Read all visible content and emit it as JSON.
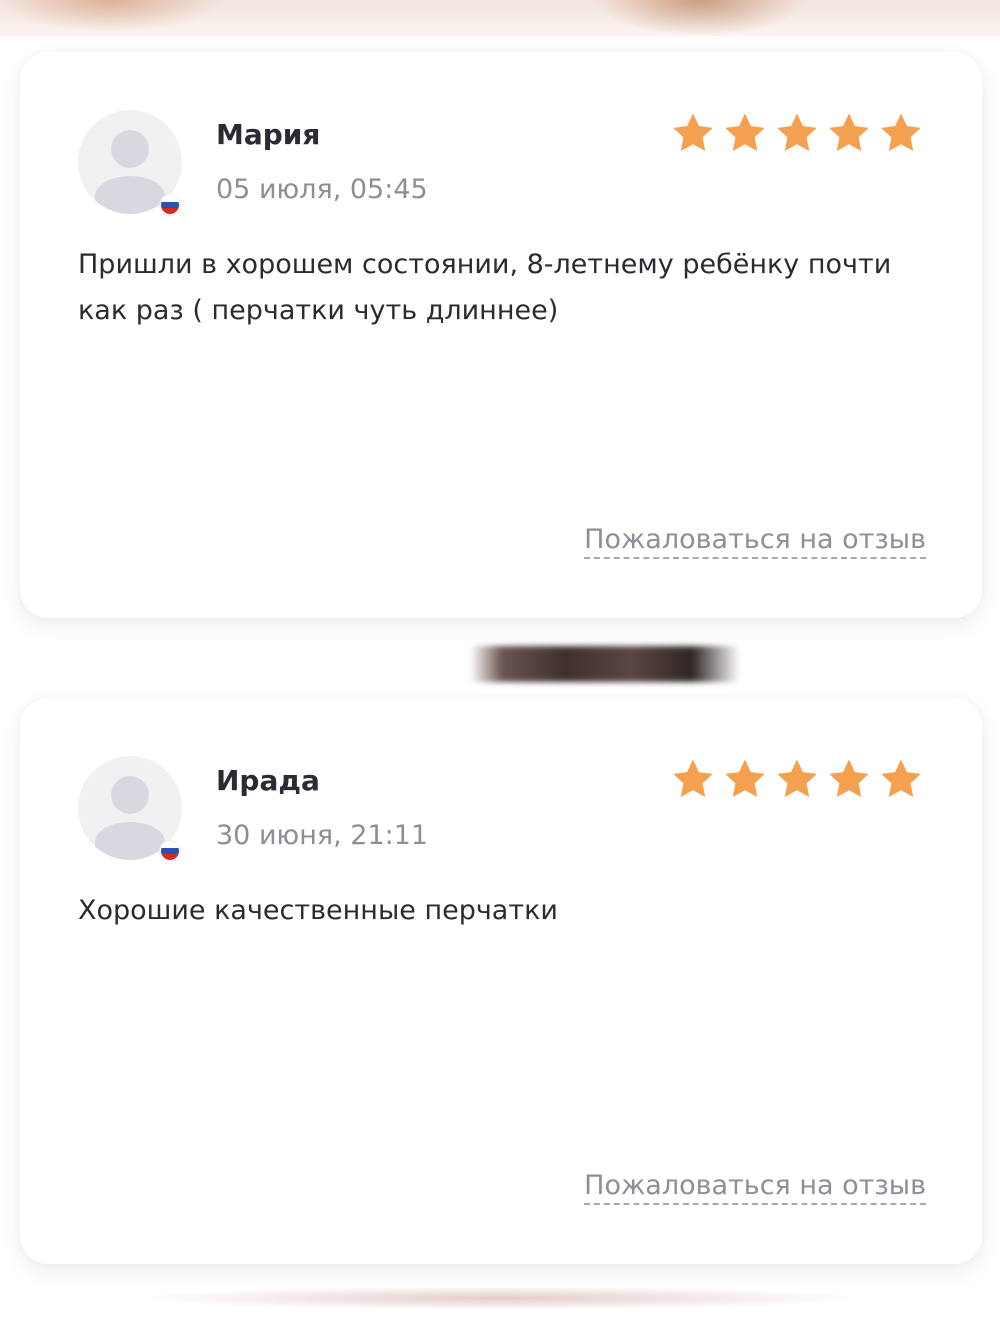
{
  "theme": {
    "star_color": "#f4a04e",
    "text_color": "#2b2b33",
    "muted_color": "#8e8e98"
  },
  "reviews": [
    {
      "author": "Мария",
      "date": "05 июля, 05:45",
      "rating": 5,
      "rating_max": 5,
      "country_flag_icon": "russia-flag-icon",
      "text": "Пришли в хорошем состоянии, 8-летнему ребёнку почти как раз ( перчатки чуть длиннее)",
      "complain_label": "Пожаловаться на отзыв"
    },
    {
      "author": "Ирада",
      "date": "30 июня, 21:11",
      "rating": 5,
      "rating_max": 5,
      "country_flag_icon": "russia-flag-icon",
      "text": "Хорошие качественные перчатки",
      "complain_label": "Пожаловаться на отзыв"
    }
  ]
}
